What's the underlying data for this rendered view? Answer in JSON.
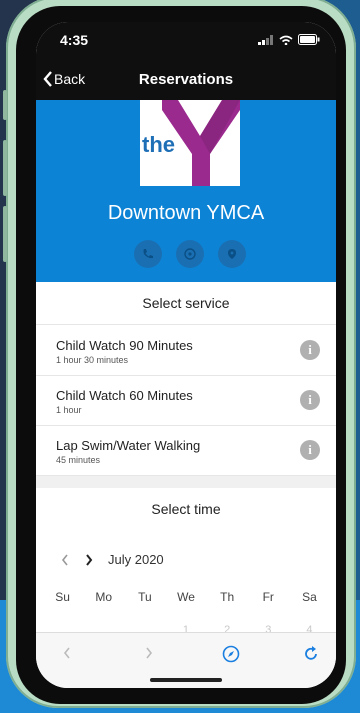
{
  "status": {
    "time": "4:35"
  },
  "nav": {
    "back_label": "Back",
    "title": "Reservations"
  },
  "location": {
    "name": "Downtown YMCA",
    "logo_text": "the",
    "logo_sub": "YMCA"
  },
  "services": {
    "header": "Select service",
    "items": [
      {
        "name": "Child Watch 90 Minutes",
        "duration": "1 hour 30 minutes"
      },
      {
        "name": "Child Watch 60 Minutes",
        "duration": "1 hour"
      },
      {
        "name": "Lap Swim/Water Walking",
        "duration": "45 minutes"
      }
    ]
  },
  "time": {
    "header": "Select time",
    "month": "July 2020",
    "weekdays": [
      "Su",
      "Mo",
      "Tu",
      "We",
      "Th",
      "Fr",
      "Sa"
    ],
    "first_week": [
      "",
      "",
      "",
      "1",
      "2",
      "3",
      "4"
    ]
  },
  "colors": {
    "brand_blue": "#0d83d5",
    "ymca_purple": "#9b2a8f",
    "ymca_blue": "#1f6fb7"
  }
}
